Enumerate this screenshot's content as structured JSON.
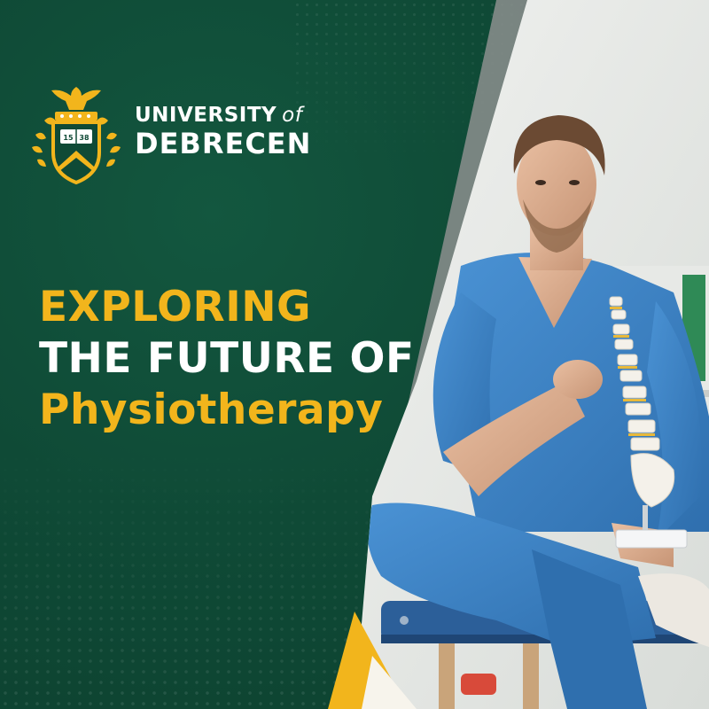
{
  "brand": {
    "line1_word": "UNIVERSITY",
    "line1_of": "of",
    "line2": "DEBRECEN",
    "crest_year": "1538"
  },
  "headline": {
    "line1": "EXPLORING",
    "line2": "THE FUTURE OF",
    "line3": "Physiotherapy"
  },
  "colors": {
    "green": "#0f4a36",
    "gold": "#f2b51c",
    "white": "#ffffff",
    "scrub_blue": "#3b84c8"
  },
  "icons": {
    "crest": "university-crest-icon"
  }
}
